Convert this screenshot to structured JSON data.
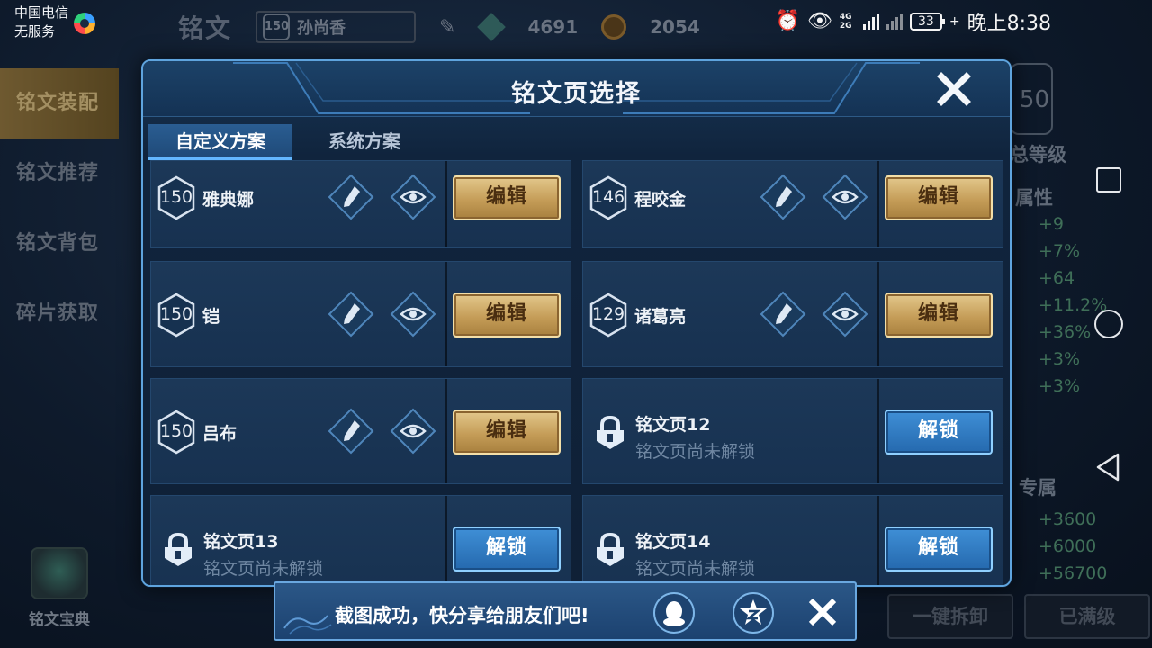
{
  "status_bar": {
    "carrier_line1": "中国电信",
    "carrier_line2": "无服务",
    "network": "4G 2G",
    "battery": "33",
    "time": "晚上8:38"
  },
  "background": {
    "screen_title": "铭文",
    "hero_level": "150",
    "hero_name": "孙尚香",
    "currency1": "4691",
    "currency2": "2054",
    "menu": [
      "铭文装配",
      "铭文推荐",
      "铭文背包",
      "碎片获取"
    ],
    "book_label": "铭文宝典",
    "right_level": "50",
    "right_label1": "总等级",
    "right_label2": "属性",
    "right_stats": [
      "+9",
      "+7%",
      "+64",
      "+11.2%",
      "+36%",
      "+3%",
      "+3%"
    ],
    "right_label3": "专属",
    "right_stats2": [
      "+3600",
      "+6000",
      "+56700"
    ],
    "btn_unload": "一键拆卸",
    "btn_full": "已满级"
  },
  "dialog": {
    "title": "铭文页选择",
    "tabs": [
      "自定义方案",
      "系统方案"
    ],
    "edit_label": "编辑",
    "unlock_label": "解锁",
    "locked_sub": "铭文页尚未解锁",
    "pages": [
      {
        "level": "150",
        "hero": "雅典娜"
      },
      {
        "level": "146",
        "hero": "程咬金"
      },
      {
        "level": "150",
        "hero": "铠"
      },
      {
        "level": "129",
        "hero": "诸葛亮"
      },
      {
        "level": "150",
        "hero": "吕布"
      }
    ],
    "locked_pages": [
      "铭文页12",
      "铭文页13",
      "铭文页14"
    ]
  },
  "toast": {
    "text": "截图成功，快分享给朋友们吧!",
    "icons": [
      "qq-icon",
      "qzone-icon"
    ]
  },
  "colors": {
    "gold_button": "#c59d58",
    "blue_button": "#2569ae",
    "dialog_border": "#5fa4de"
  }
}
